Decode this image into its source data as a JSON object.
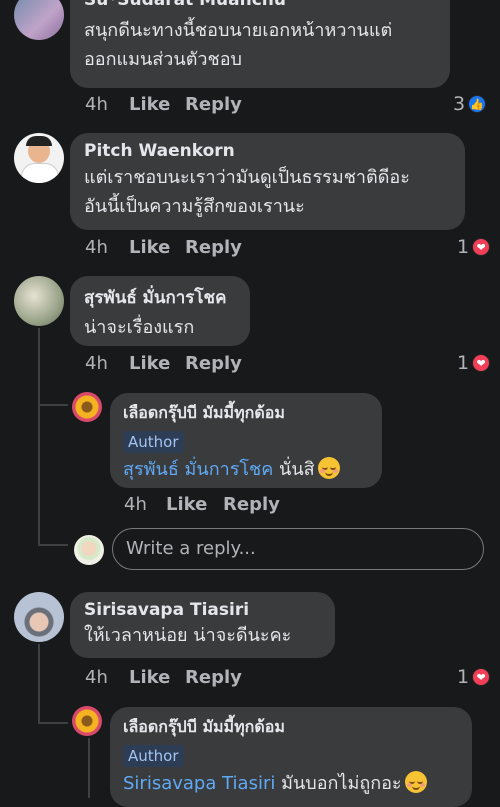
{
  "comments": [
    {
      "name": "Su*Sudarat Muanchu",
      "lines": [
        "สนุกดีนะทางนี้ชอบนายเอกหน้าหวานแต่",
        "ออกแมนส่วนตัวชอบ"
      ],
      "time": "4h",
      "like": "Like",
      "reply": "Reply",
      "reaction_count": "3",
      "reaction_icon": "thumbs-up-icon",
      "reaction_color": "#1877f2"
    },
    {
      "name": "Pitch Waenkorn",
      "lines": [
        "แต่เราชอบนะเราว่ามันดูเป็นธรรมชาติดีอะ",
        "อันนี้เป็นความรู้สึกของเรานะ"
      ],
      "time": "4h",
      "like": "Like",
      "reply": "Reply",
      "reaction_count": "1",
      "reaction_icon": "heart-icon",
      "reaction_color": "#f33e58"
    },
    {
      "name": "สุรพันธ์ มั่นการโชค",
      "lines": [
        "น่าจะเรื่องแรก"
      ],
      "time": "4h",
      "like": "Like",
      "reply": "Reply",
      "reaction_count": "1",
      "reaction_icon": "heart-icon",
      "reaction_color": "#f33e58"
    },
    {
      "name": "Sirisavapa Tiasiri",
      "lines": [
        "ให้เวลาหน่อย  น่าจะดีนะคะ"
      ],
      "time": "4h",
      "like": "Like",
      "reply": "Reply",
      "reaction_count": "1",
      "reaction_icon": "heart-icon",
      "reaction_color": "#f33e58"
    }
  ],
  "replies": [
    {
      "name": "เลือดกรุ๊ปบี มัมมี้ทุกด้อม",
      "badge": "Author",
      "mention": "สุรพันธ์ มั่นการโชค",
      "text": "นั่นสิ",
      "emoji": "smiling-face-icon",
      "time": "4h",
      "like": "Like",
      "reply": "Reply"
    },
    {
      "name": "เลือดกรุ๊ปบี มัมมี้ทุกด้อม",
      "badge": "Author",
      "mention": "Sirisavapa Tiasiri",
      "text": "มันบอกไม่ถูกอะ",
      "emoji": "smiling-face-icon"
    }
  ],
  "composer": {
    "placeholder": "Write a reply..."
  },
  "colors": {
    "background": "#18191a",
    "bubble": "#3a3b3c",
    "mention": "#5fa9f6",
    "badge": "#2d3d55"
  }
}
